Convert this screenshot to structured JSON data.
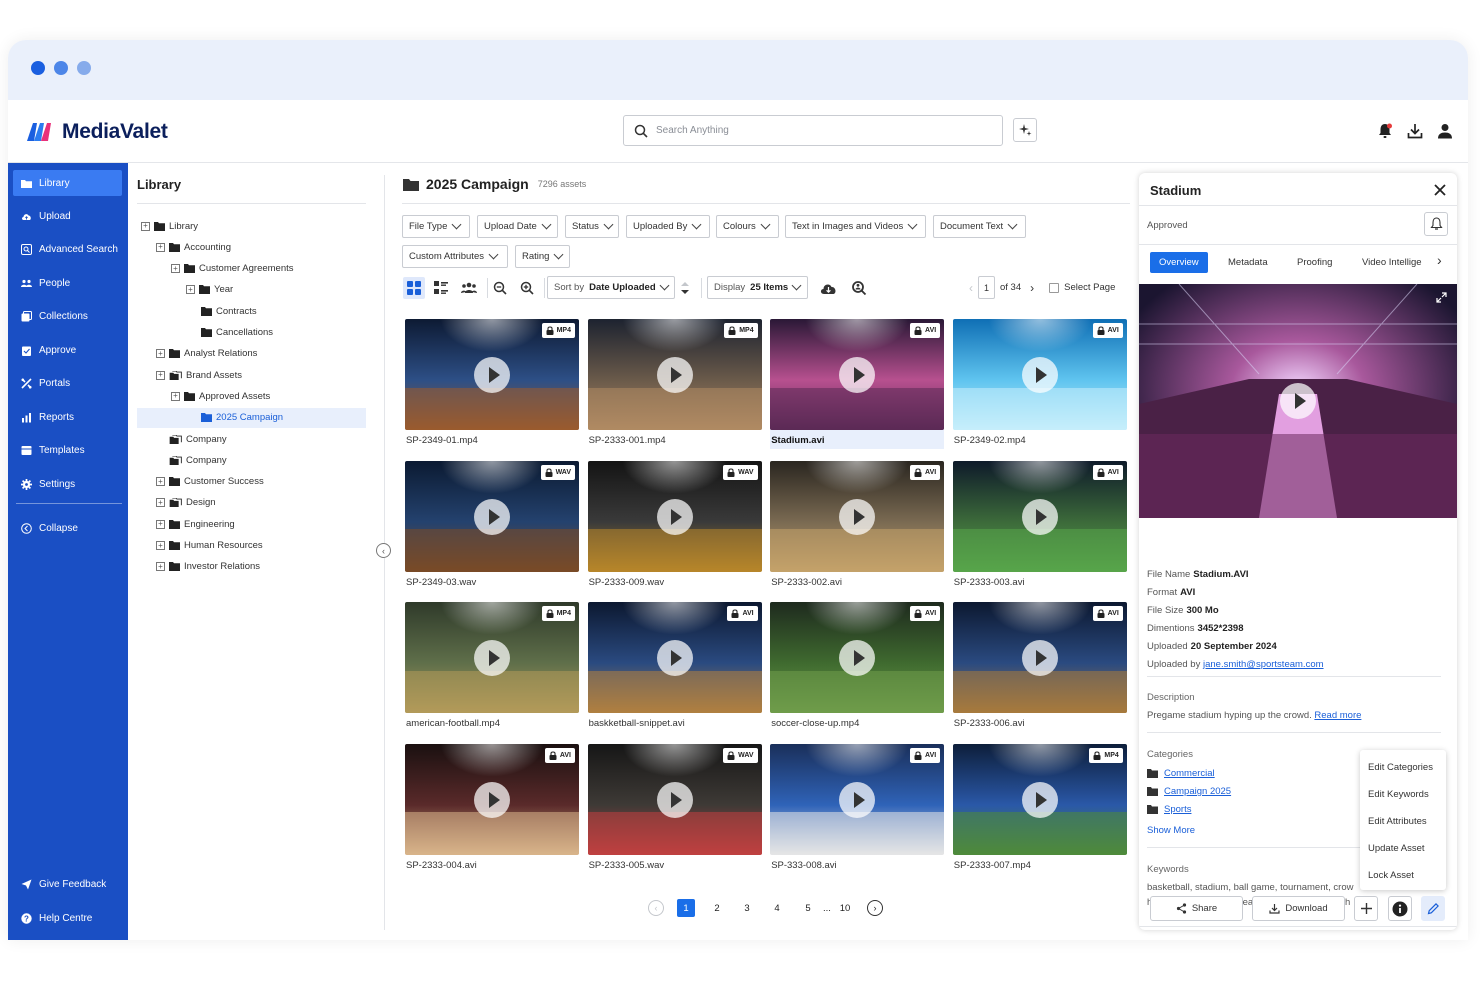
{
  "brand": {
    "name": "MediaValet"
  },
  "search": {
    "placeholder": "Search Anything"
  },
  "sidebar": {
    "items": [
      {
        "label": "Library"
      },
      {
        "label": "Upload"
      },
      {
        "label": "Advanced Search"
      },
      {
        "label": "People"
      },
      {
        "label": "Collections"
      },
      {
        "label": "Approve"
      },
      {
        "label": "Portals"
      },
      {
        "label": "Reports"
      },
      {
        "label": "Templates"
      },
      {
        "label": "Settings"
      },
      {
        "label": "Collapse"
      },
      {
        "label": "Give Feedback"
      },
      {
        "label": "Help Centre"
      }
    ]
  },
  "tree": {
    "title": "Library",
    "nodes": [
      {
        "label": "Library"
      },
      {
        "label": "Accounting"
      },
      {
        "label": "Customer Agreements"
      },
      {
        "label": "Year"
      },
      {
        "label": "Contracts"
      },
      {
        "label": "Cancellations"
      },
      {
        "label": "Analyst Relations"
      },
      {
        "label": "Brand Assets"
      },
      {
        "label": "Approved Assets"
      },
      {
        "label": "2025 Campaign"
      },
      {
        "label": "Company"
      },
      {
        "label": "Company"
      },
      {
        "label": "Customer Success"
      },
      {
        "label": "Design"
      },
      {
        "label": "Engineering"
      },
      {
        "label": "Human Resources"
      },
      {
        "label": "Investor Relations"
      }
    ]
  },
  "main": {
    "title": "2025 Campaign",
    "asset_count": "7296 assets",
    "filters": [
      {
        "label": "File Type"
      },
      {
        "label": "Upload Date"
      },
      {
        "label": "Status"
      },
      {
        "label": "Uploaded By"
      },
      {
        "label": "Colours"
      },
      {
        "label": "Text in Images and Videos"
      },
      {
        "label": "Document Text"
      },
      {
        "label": "Custom Attributes"
      },
      {
        "label": "Rating"
      }
    ],
    "sort_prefix": "Sort by",
    "sort_value": "Date Uploaded",
    "display_prefix": "Display",
    "display_value": "25 Items",
    "page_current": "1",
    "page_of": "of 34",
    "select_page": "Select Page",
    "assets": [
      {
        "name": "SP-2349-01.mp4",
        "format": "MP4"
      },
      {
        "name": "SP-2333-001.mp4",
        "format": "MP4"
      },
      {
        "name": "Stadium.avi",
        "format": "AVI"
      },
      {
        "name": "SP-2349-02.mp4",
        "format": "AVI"
      },
      {
        "name": "SP-2349-03.wav",
        "format": "WAV"
      },
      {
        "name": "SP-2333-009.wav",
        "format": "WAV"
      },
      {
        "name": "SP-2333-002.avi",
        "format": "AVI"
      },
      {
        "name": "SP-2333-003.avi",
        "format": "AVI"
      },
      {
        "name": "american-football.mp4",
        "format": "MP4"
      },
      {
        "name": "baskketball-snippet.avi",
        "format": "AVI"
      },
      {
        "name": "soccer-close-up.mp4",
        "format": "AVI"
      },
      {
        "name": "SP-2333-006.avi",
        "format": "AVI"
      },
      {
        "name": "SP-2333-004.avi",
        "format": "AVI"
      },
      {
        "name": "SP-2333-005.wav",
        "format": "WAV"
      },
      {
        "name": "SP-333-008.avi",
        "format": "AVI"
      },
      {
        "name": "SP-2333-007.mp4",
        "format": "MP4"
      }
    ],
    "pagination": {
      "pages": [
        "1",
        "2",
        "3",
        "4",
        "5"
      ],
      "ellipsis": "...",
      "last": "10"
    }
  },
  "panel": {
    "title": "Stadium",
    "status": "Approved",
    "tabs": [
      {
        "label": "Overview"
      },
      {
        "label": "Metadata"
      },
      {
        "label": "Proofing"
      },
      {
        "label": "Video Intellige"
      }
    ],
    "meta": {
      "file_name_label": "File Name",
      "file_name": "Stadium.AVI",
      "format_label": "Format",
      "format": "AVI",
      "size_label": "File Size",
      "size": "300 Mo",
      "dims_label": "Dimentions",
      "dims": "3452*2398",
      "uploaded_label": "Uploaded",
      "uploaded": "20 September 2024",
      "uploader_label": "Uploaded by",
      "uploader": "jane.smith@sportsteam.com"
    },
    "description_label": "Description",
    "description": "Pregame stadium hyping up the crowd.",
    "read_more": "Read more",
    "categories_label": "Categories",
    "categories": [
      {
        "label": "Commercial"
      },
      {
        "label": "Campaign 2025"
      },
      {
        "label": "Sports"
      }
    ],
    "show_more": "Show More",
    "keywords_label": "Keywords",
    "keywords_line1": "basketball, stadium, ball game, tournament, crow",
    "keywords_line2": "hype, cheering, youth league, finals, half time sh",
    "menu": [
      {
        "label": "Edit Categories"
      },
      {
        "label": "Edit Keywords"
      },
      {
        "label": "Edit Attributes"
      },
      {
        "label": "Update Asset"
      },
      {
        "label": "Lock Asset"
      }
    ],
    "share_label": "Share",
    "download_label": "Download"
  },
  "colors": {
    "sidebar": "#1a4fc4",
    "accent": "#1a6ee8",
    "active_nav": "#3a7bf2"
  }
}
